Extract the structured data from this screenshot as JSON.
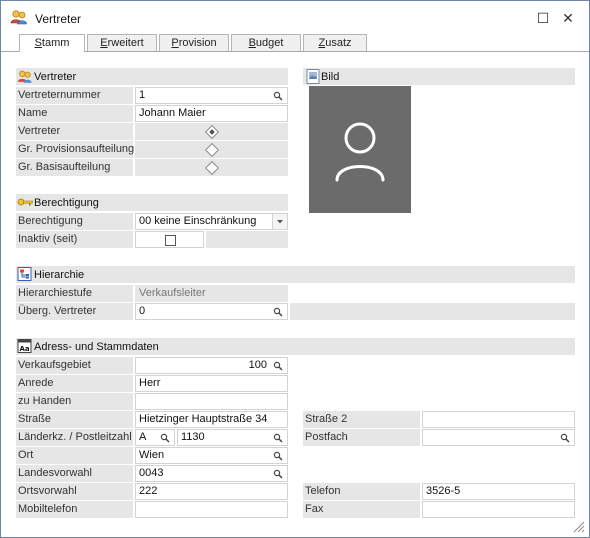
{
  "window": {
    "title": "Vertreter",
    "icon": "users-icon",
    "maximize_glyph": "☐",
    "close_glyph": "✕"
  },
  "tabs": [
    {
      "prefix": "",
      "accel": "S",
      "rest": "tamm",
      "active": true
    },
    {
      "prefix": "",
      "accel": "E",
      "rest": "rweitert",
      "active": false
    },
    {
      "prefix": "",
      "accel": "P",
      "rest": "rovision",
      "active": false
    },
    {
      "prefix": "",
      "accel": "B",
      "rest": "udget",
      "active": false
    },
    {
      "prefix": "",
      "accel": "Z",
      "rest": "usatz",
      "active": false
    }
  ],
  "sections": {
    "vertreter": {
      "title": "Vertreter",
      "icon": "users-icon",
      "rows": {
        "vertreternummer": {
          "label": "Vertreternummer",
          "value": "1"
        },
        "name": {
          "label": "Name",
          "value": "Johann Maier"
        },
        "vertreter": {
          "label": "Vertreter",
          "checked": true
        },
        "provision": {
          "label": "Gr. Provisionsaufteilung",
          "checked": false
        },
        "basis": {
          "label": "Gr. Basisaufteilung",
          "checked": false
        }
      }
    },
    "bild": {
      "title": "Bild",
      "icon": "picture-icon"
    },
    "berechtigung": {
      "title": "Berechtigung",
      "icon": "key-icon",
      "rows": {
        "berechtigung": {
          "label": "Berechtigung",
          "value": "00 keine Einschränkung"
        },
        "inaktiv": {
          "label": "Inaktiv (seit)",
          "checked": false
        }
      }
    },
    "hierarchie": {
      "title": "Hierarchie",
      "icon": "hierarchy-icon",
      "rows": {
        "stufe": {
          "label": "Hierarchiestufe",
          "value": "Verkaufsleiter"
        },
        "uebergeordnet": {
          "label": "Überg. Vertreter",
          "value": "0"
        }
      }
    },
    "adresse": {
      "title": "Adress- und Stammdaten",
      "icon": "address-book-icon",
      "rows": {
        "verkaufsgebiet": {
          "label": "Verkaufsgebiet",
          "value": "100"
        },
        "anrede": {
          "label": "Anrede",
          "value": "Herr"
        },
        "zu_handen": {
          "label": "zu Handen",
          "value": ""
        },
        "strasse": {
          "label": "Straße",
          "value": "Hietzinger Hauptstraße 34"
        },
        "strasse2": {
          "label": "Straße 2",
          "value": ""
        },
        "laenderkz": {
          "label": "Länderkz. / Postleitzahl",
          "country": "A",
          "plz": "1130"
        },
        "postfach": {
          "label": "Postfach",
          "value": ""
        },
        "ort": {
          "label": "Ort",
          "value": "Wien"
        },
        "landesvorwahl": {
          "label": "Landesvorwahl",
          "value": "0043"
        },
        "ortsvorwahl": {
          "label": "Ortsvorwahl",
          "value": "222"
        },
        "telefon": {
          "label": "Telefon",
          "value": "3526-5"
        },
        "mobiltelefon": {
          "label": "Mobiltelefon",
          "value": ""
        },
        "fax": {
          "label": "Fax",
          "value": ""
        }
      }
    }
  },
  "colors": {
    "section_bg": "#e6e6e6",
    "photo_bg": "#6b6b6b",
    "window_border": "#6f86a8"
  }
}
